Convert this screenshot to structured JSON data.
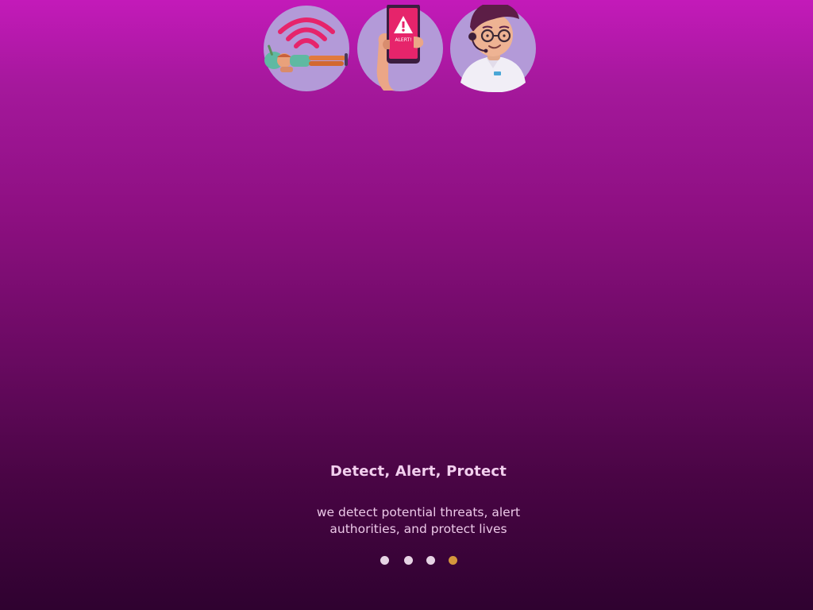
{
  "onboarding": {
    "title": "Detect, Alert, Protect",
    "description": "we detect potential threats, alert authorities, and protect lives",
    "illustrations": [
      {
        "icon": "fall-detection-wifi-icon"
      },
      {
        "icon": "phone-alert-icon",
        "text": "ALERT!"
      },
      {
        "icon": "support-agent-icon"
      }
    ],
    "pager": {
      "total_pages": 4,
      "current_page": 4
    }
  },
  "colors": {
    "background_top": "#c31ab9",
    "background_bottom": "#2f0230",
    "illustration_circle": "#b39ad8",
    "alert_pink": "#e6246b",
    "dot_inactive": "#e6d3e4",
    "dot_active": "#d4963c",
    "text": "#f2cfee"
  }
}
